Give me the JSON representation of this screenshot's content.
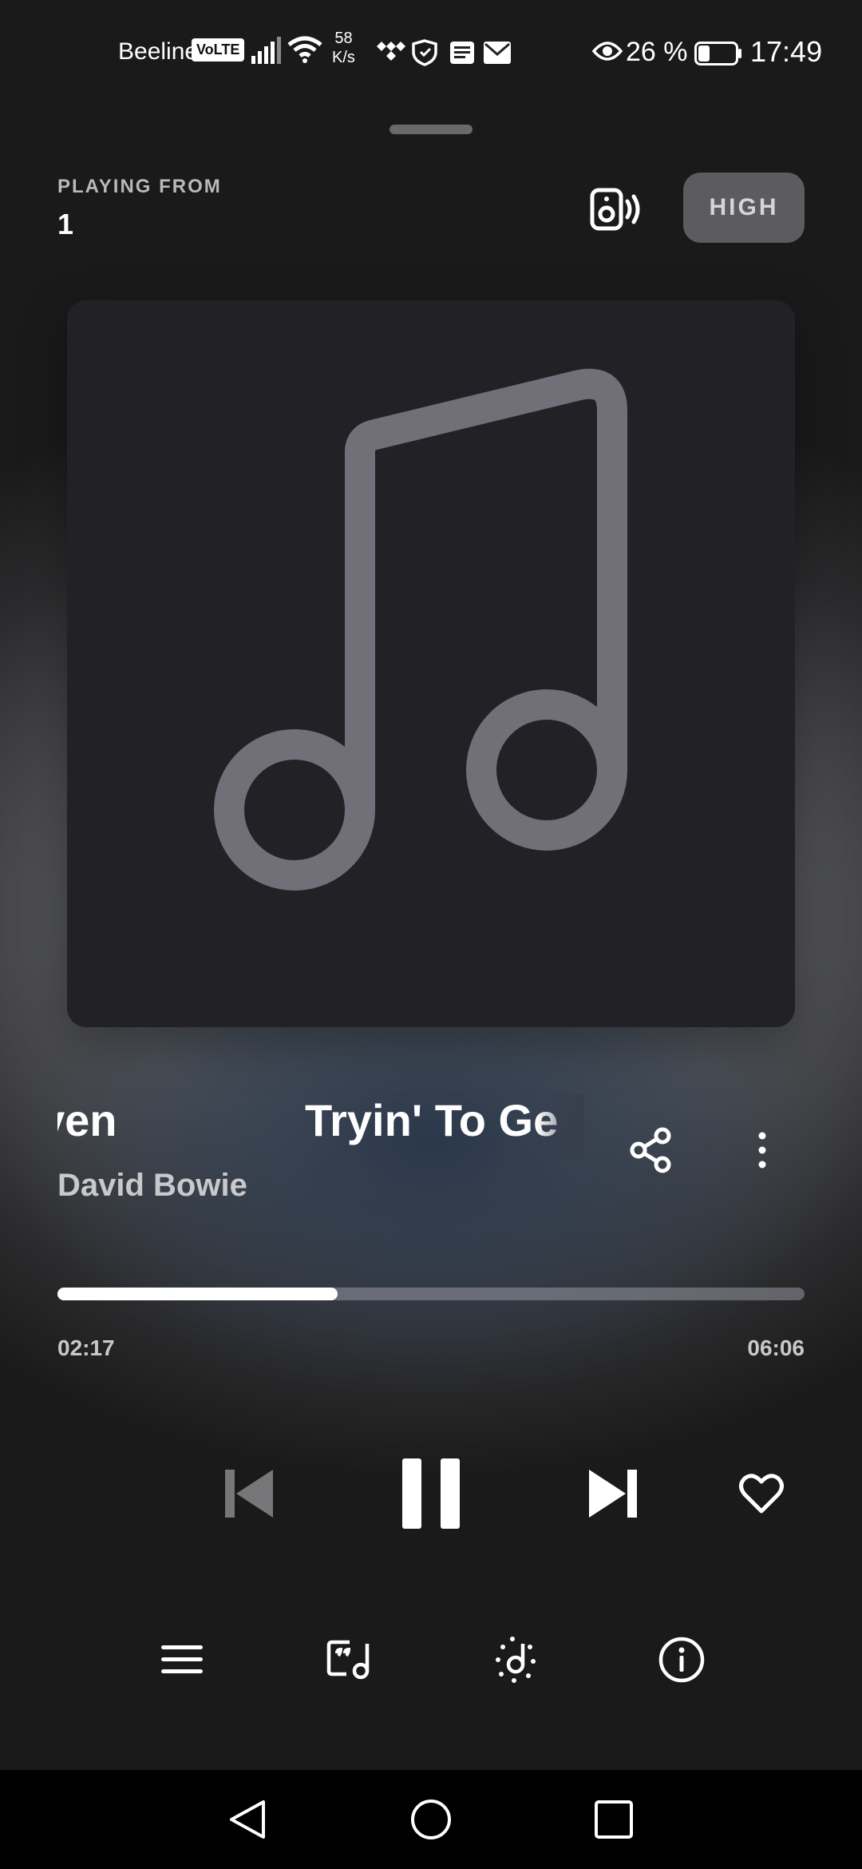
{
  "status_bar": {
    "carrier": "Beeline",
    "volte": "VoLTE",
    "net_speed_value": "58",
    "net_speed_unit": "K/s",
    "battery_percent": "26 %",
    "time": "17:49",
    "icons": [
      "signal-icon",
      "wifi-icon",
      "tidal-icon",
      "shield-icon",
      "news-icon",
      "mail-icon",
      "eye-icon",
      "battery-icon"
    ]
  },
  "header": {
    "playing_from_label": "PLAYING FROM",
    "playing_from_value": "1",
    "quality_label": "HIGH"
  },
  "track": {
    "previous_title_fragment": "ven",
    "title": "Tryin' To Ge",
    "artist": "David Bowie"
  },
  "progress": {
    "elapsed": "02:17",
    "total": "06:06",
    "fraction": 0.375
  },
  "controls": {
    "previous_icon": "skip-previous-icon",
    "pause_icon": "pause-icon",
    "next_icon": "skip-next-icon",
    "like_icon": "heart-icon"
  },
  "bottom_actions": [
    "queue-icon",
    "lyrics-icon",
    "credits-icon",
    "info-icon"
  ],
  "colors": {
    "accent": "#ffffff",
    "album_placeholder_bg": "#222126",
    "note_color": "#717079",
    "quality_button_bg": "#77777d"
  }
}
